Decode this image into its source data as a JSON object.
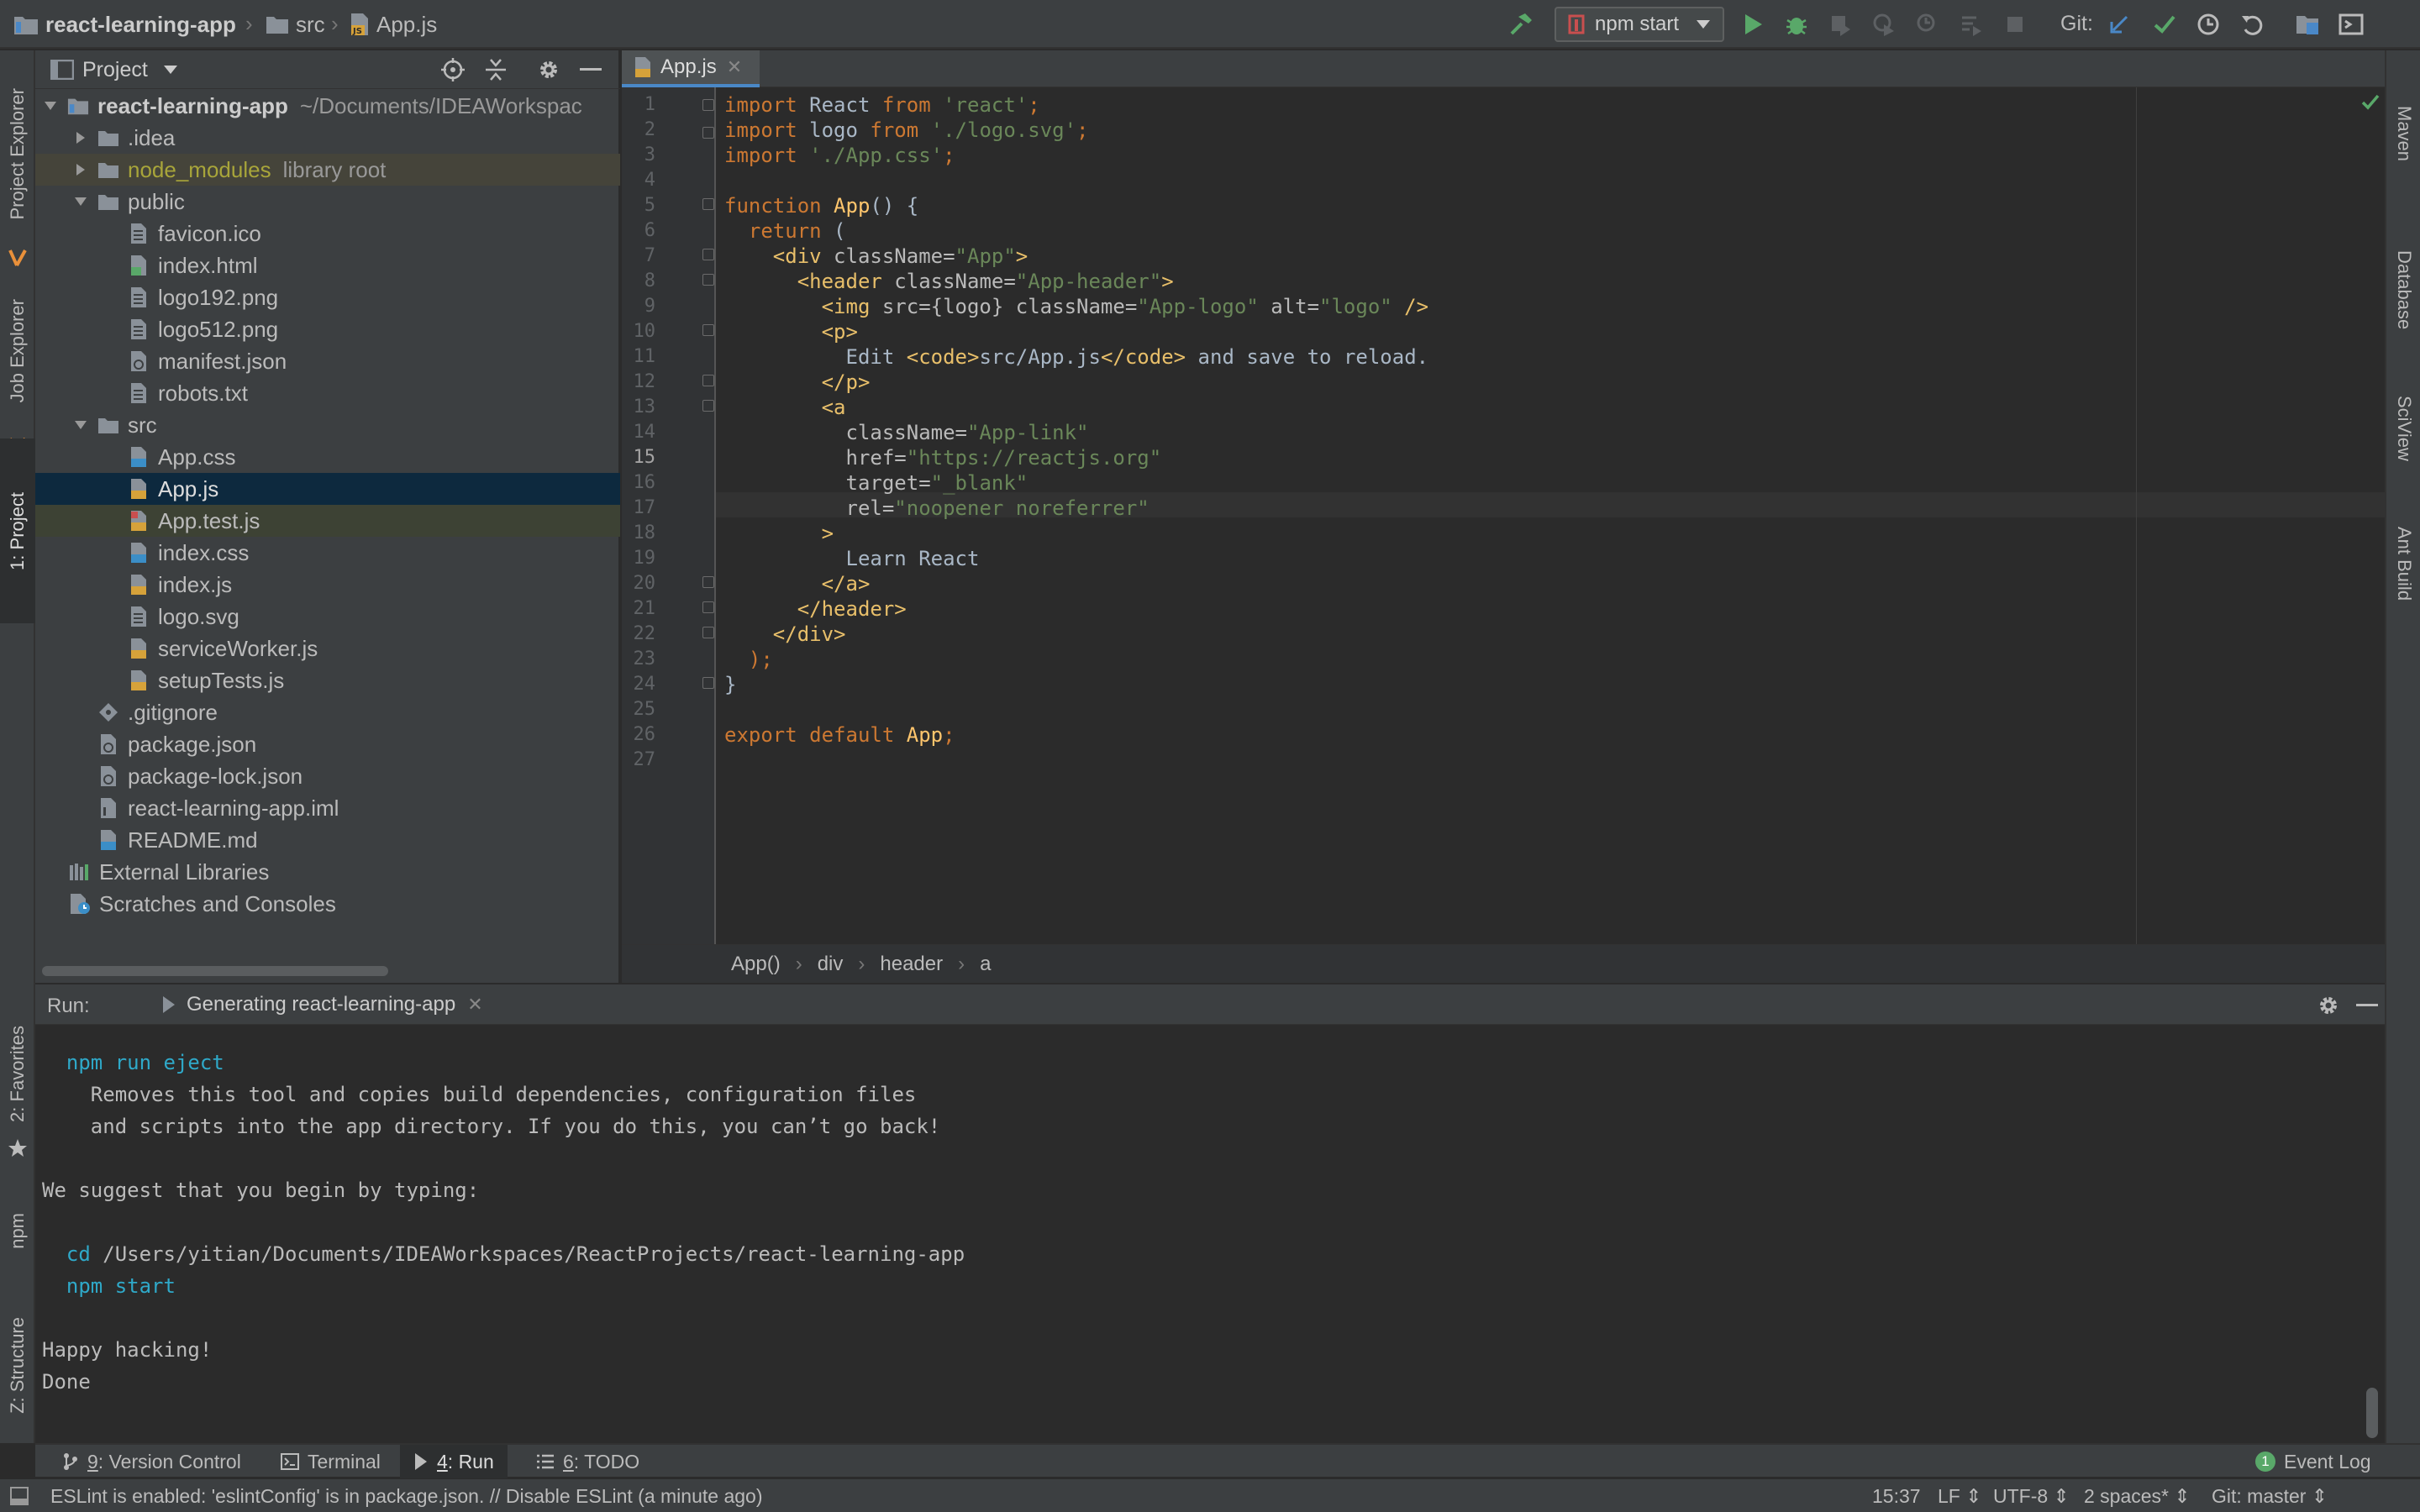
{
  "breadcrumb": {
    "project": "react-learning-app",
    "folder": "src",
    "file": "App.js"
  },
  "toolbar": {
    "run_config": "npm start",
    "git_label": "Git:"
  },
  "left_tabs": [
    "Project Explorer",
    "Job Explorer",
    "1: Project",
    "2: Favorites",
    "npm",
    "Z: Structure"
  ],
  "right_tabs": [
    "Maven",
    "Database",
    "SciView",
    "Ant Build"
  ],
  "project_panel": {
    "title": "Project",
    "tree": [
      {
        "label": "react-learning-app",
        "extra": "~/Documents/IDEAWorkspac"
      },
      {
        "label": ".idea"
      },
      {
        "label": "node_modules",
        "extra": "library root"
      },
      {
        "label": "public"
      },
      {
        "label": "favicon.ico"
      },
      {
        "label": "index.html"
      },
      {
        "label": "logo192.png"
      },
      {
        "label": "logo512.png"
      },
      {
        "label": "manifest.json"
      },
      {
        "label": "robots.txt"
      },
      {
        "label": "src"
      },
      {
        "label": "App.css"
      },
      {
        "label": "App.js"
      },
      {
        "label": "App.test.js"
      },
      {
        "label": "index.css"
      },
      {
        "label": "index.js"
      },
      {
        "label": "logo.svg"
      },
      {
        "label": "serviceWorker.js"
      },
      {
        "label": "setupTests.js"
      },
      {
        "label": ".gitignore"
      },
      {
        "label": "package.json"
      },
      {
        "label": "package-lock.json"
      },
      {
        "label": "react-learning-app.iml"
      },
      {
        "label": "README.md"
      },
      {
        "label": "External Libraries"
      },
      {
        "label": "Scratches and Consoles"
      }
    ]
  },
  "editor": {
    "tab": "App.js",
    "line_numbers": [
      "1",
      "2",
      "3",
      "4",
      "5",
      "6",
      "7",
      "8",
      "9",
      "10",
      "11",
      "12",
      "13",
      "14",
      "15",
      "16",
      "17",
      "18",
      "19",
      "20",
      "21",
      "22",
      "23",
      "24",
      "25",
      "26",
      "27"
    ],
    "code": {
      "l1a": "import",
      "l1b": " React ",
      "l1c": "from",
      "l1d": " 'react'",
      "l1e": ";",
      "l2a": "import",
      "l2b": " logo ",
      "l2c": "from",
      "l2d": " './logo.svg'",
      "l2e": ";",
      "l3a": "import",
      "l3d": " './App.css'",
      "l3e": ";",
      "l5a": "function",
      "l5b": " App",
      "l5c": "() {",
      "l6a": "  return",
      "l6b": " (",
      "l7a": "    <div",
      "l7b": " className=",
      "l7c": "\"App\"",
      "l7d": ">",
      "l8a": "      <header",
      "l8b": " className=",
      "l8c": "\"App-header\"",
      "l8d": ">",
      "l9a": "        <img",
      "l9b": " src={logo} className=",
      "l9c": "\"App-logo\"",
      "l9d": " alt=",
      "l9e": "\"logo\"",
      "l9f": " />",
      "l10a": "        <p>",
      "l11a": "          Edit ",
      "l11b": "<code>",
      "l11c": "src/App.js",
      "l11d": "</code>",
      "l11e": " and save to reload.",
      "l12a": "        </p>",
      "l13a": "        <a",
      "l14a": "          className=",
      "l14b": "\"App-link\"",
      "l15a": "          href=",
      "l15b": "\"https://reactjs.org\"",
      "l16a": "          target=",
      "l16b": "\"_blank\"",
      "l17a": "          rel=",
      "l17b": "\"noopener noreferrer\"",
      "l18a": "        >",
      "l19a": "          Learn React",
      "l20a": "        </a>",
      "l21a": "      </header>",
      "l22a": "    </div>",
      "l23a": "  );",
      "l24a": "}",
      "l26a": "export default",
      "l26b": " App",
      "l26c": ";"
    },
    "crumbs": [
      "App()",
      "div",
      "header",
      "a"
    ]
  },
  "run_panel": {
    "label": "Run:",
    "tab": "Generating react-learning-app",
    "lines": {
      "c1": "  npm run eject",
      "c2": "    Removes this tool and copies build dependencies, configuration files",
      "c3": "    and scripts into the app directory. If you do this, you can’t go back!",
      "c4": "We suggest that you begin by typing:",
      "c5a": "  cd",
      "c5b": " /Users/yitian/Documents/IDEAWorkspaces/ReactProjects/react-learning-app",
      "c6": "  npm start",
      "c7": "Happy hacking!",
      "c8": "Done"
    }
  },
  "bottom_tabs": {
    "vc_num": "9",
    "vc": ": Version Control",
    "terminal": "Terminal",
    "run_num": "4",
    "run": ": Run",
    "todo_num": "6",
    "todo": ": TODO",
    "event_badge": "1",
    "event_log": "Event Log"
  },
  "status": {
    "message": "ESLint is enabled: 'eslintConfig' is in package.json. // Disable ESLint (a minute ago)",
    "position": "15:37",
    "line_sep": "LF",
    "encoding": "UTF-8",
    "indent": "2 spaces*",
    "git": "Git: master"
  },
  "colors": {
    "accent": "#4a88c7",
    "keyword": "#cc7832",
    "string": "#6a8759",
    "tag": "#e8bf6a",
    "function": "#ffc66d",
    "console_cmd": "#2fa9c9"
  }
}
